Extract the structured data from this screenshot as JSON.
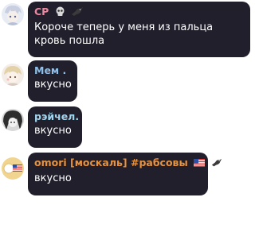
{
  "messages": [
    {
      "author": "CP",
      "name_color": "#e98aa1",
      "text": "Короче теперь у меня из пальца кровь пошла",
      "avatar": "anime-character-avatar",
      "badges": [
        "skull-emoji",
        "crow-emoji"
      ]
    },
    {
      "author": "Мем .",
      "name_color": "#8fbfe8",
      "text": "вкусно",
      "avatar": "anime-character-avatar",
      "badges": []
    },
    {
      "author": "рэйчел.",
      "name_color": "#9fd6ef",
      "text": "вкусно",
      "avatar": "anime-character-avatar",
      "badges": []
    },
    {
      "author": "omori [москаль] #рабсовы",
      "name_color": "#e8923b",
      "text": "вкусно",
      "avatar": "omori-avatar-with-us-flag",
      "badges": [
        "us-flag-emoji",
        "crow-emoji"
      ]
    }
  ]
}
